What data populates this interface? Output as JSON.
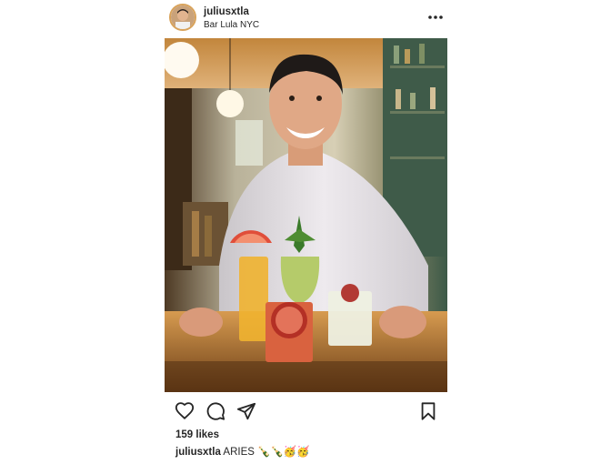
{
  "post": {
    "username": "juliusxtla",
    "location": "Bar Lula NYC",
    "likes": "159 likes",
    "caption_user": "juliusxtla",
    "caption_text": "ARIES 🍾🍾🥳🥳"
  },
  "icons": {
    "more": "more-options-icon",
    "like": "heart-icon",
    "comment": "comment-icon",
    "share": "send-icon",
    "save": "bookmark-icon"
  },
  "colors": {
    "text": "#262626",
    "avatar_ring": "#d8a25a",
    "background": "#ffffff"
  }
}
